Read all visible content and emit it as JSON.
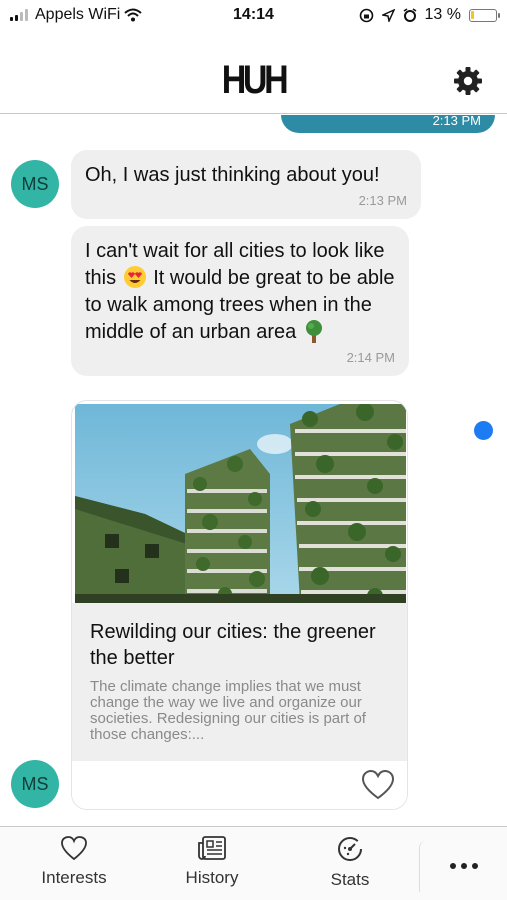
{
  "status_bar": {
    "carrier": "Appels WiFi",
    "time": "14:14",
    "battery": "13 %",
    "battery_level": 0.13,
    "battery_color": "#f5c518"
  },
  "header": {
    "logo": "HUH",
    "settings_icon": "gear-icon"
  },
  "chat": {
    "sent_partial": {
      "time": "2:13 PM",
      "color": "#2e8ba5"
    },
    "messages": [
      {
        "avatar": "MS",
        "text": "Oh, I was just thinking about you!",
        "time": "2:13 PM"
      },
      {
        "text_part1": "I can't wait for all cities to look like this",
        "emoji1": "heart-eyes-emoji",
        "text_part2": "It would be great to be able to walk among trees when in the middle of an urban area",
        "emoji2": "tree-emoji",
        "time": "2:14 PM"
      }
    ],
    "card": {
      "image": "vertical-forest-photo",
      "title": "Rewilding our cities: the greener the better",
      "description": "The climate change implies that we must change the way we live and organize our societies. Redesigning our cities is part of those changes:...",
      "like_icon": "heart-outline-icon"
    },
    "card_avatar": "MS",
    "avatar_color": "#33b5a6",
    "unread_dot_color": "#1e7cf2"
  },
  "tabs": [
    {
      "label": "Interests",
      "icon": "heart-icon"
    },
    {
      "label": "History",
      "icon": "newspaper-icon"
    },
    {
      "label": "Stats",
      "icon": "stats-dial-icon"
    },
    {
      "label": "",
      "icon": "more-dots-icon"
    }
  ]
}
